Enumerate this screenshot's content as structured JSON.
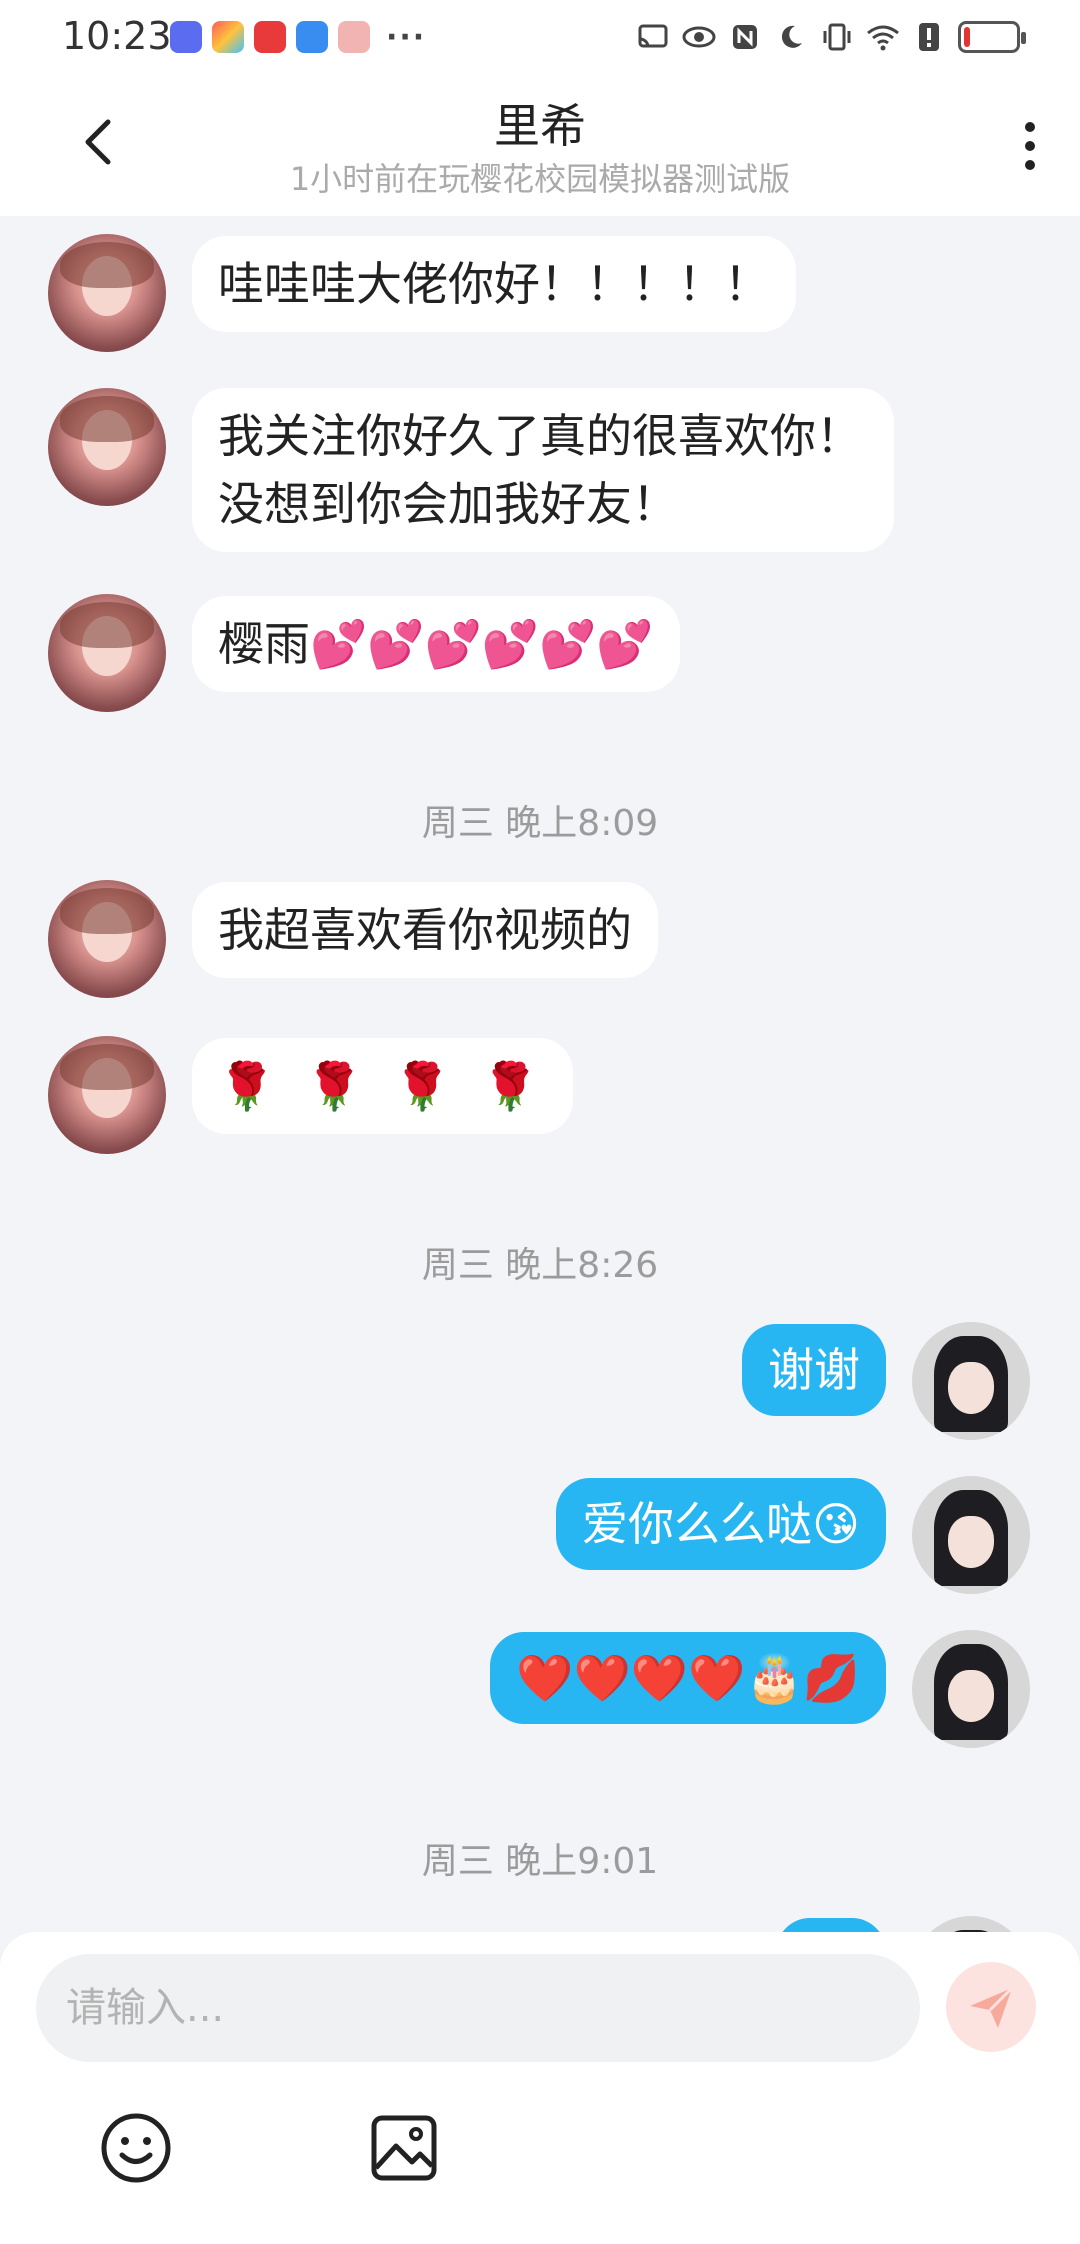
{
  "status_bar": {
    "time": "10:23",
    "notification_icons": [
      "music-app-icon",
      "app-grid-icon",
      "huawei-store-icon",
      "cloud-icon",
      "gift-box-icon"
    ],
    "overflow": "···",
    "system_icons": [
      "cast-icon",
      "eye-icon",
      "nfc-icon",
      "moon-icon",
      "vibrate-icon",
      "wifi-icon",
      "alert-icon"
    ],
    "battery_level": 0.1,
    "battery_color": "#e33333"
  },
  "header": {
    "title": "里希",
    "subtitle": "1小时前在玩樱花校园模拟器测试版"
  },
  "messages": {
    "m1": "哇哇哇大佬你好！！！！！",
    "m2": "我关注你好久了真的很喜欢你！没想到你会加我好友！",
    "m3": "樱雨💕💕💕💕💕💕",
    "ts1": "周三 晚上8:09",
    "m4": "我超喜欢看你视频的",
    "m5": "🌹 🌹 🌹 🌹",
    "ts2": "周三 晚上8:26",
    "m6": "谢谢",
    "m7": "爱你么么哒😘",
    "m8": "❤️❤️❤️❤️🎂💋",
    "ts3": "周三 晚上9:01"
  },
  "input": {
    "placeholder": "请输入..."
  },
  "colors": {
    "accent_bubble": "#27b6f2",
    "send_button": "#f7a99c",
    "background": "#f3f4f7"
  }
}
